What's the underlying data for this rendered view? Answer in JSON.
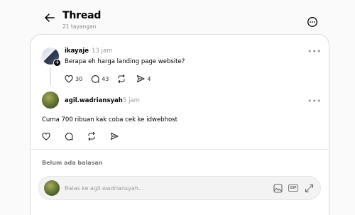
{
  "header": {
    "title": "Thread",
    "views": "21 tayangan",
    "back_icon": "arrow-left-icon",
    "more_icon": "more-circle-icon"
  },
  "post": {
    "username": "ikayaje",
    "time": "13 jam",
    "text": "Berapa eh harga landing page website?",
    "likes": "30",
    "comments": "43",
    "shares": "4",
    "more": "•••"
  },
  "reply": {
    "username": "agil.wadriansyah",
    "time": "5 jam",
    "text": "Cuma 700 ribuan kak coba cek ke idwebhost",
    "more": "•••"
  },
  "no_replies_label": "Belum ada balasan",
  "composer": {
    "placeholder": "Balas ke agil.wadriansyah...",
    "gif_label": "GIF"
  },
  "colors": {
    "accent": "#000000",
    "muted": "#9a9a9a",
    "border": "#dcdcdc"
  }
}
